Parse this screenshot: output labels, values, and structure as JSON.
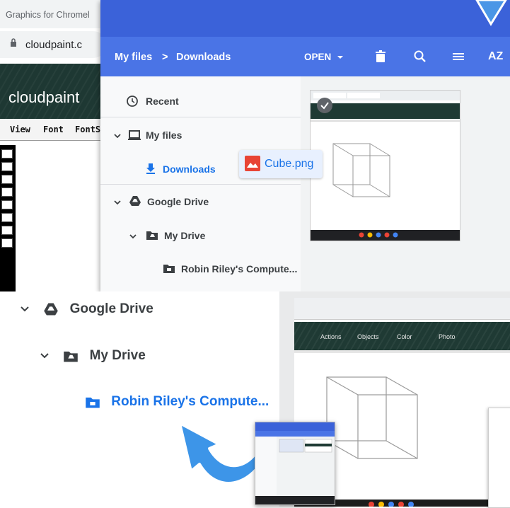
{
  "browser": {
    "tab_title": "Graphics for Chromel",
    "url": "cloudpaint.c",
    "brand": "cloudpaint",
    "menu": [
      "View",
      "Font",
      "FontS"
    ]
  },
  "files_app": {
    "breadcrumb": {
      "root": "My files",
      "separator": ">",
      "current": "Downloads"
    },
    "toolbar": {
      "open_label": "OPEN",
      "delete_icon": "trash-icon",
      "search_icon": "search-icon",
      "view_icon": "list-view-icon",
      "sort_label": "AZ"
    },
    "sidebar": {
      "recent": "Recent",
      "my_files": "My files",
      "downloads": "Downloads",
      "google_drive": "Google Drive",
      "my_drive": "My Drive",
      "computer": "Robin Riley's Compute..."
    },
    "drag_file": "Cube.png"
  },
  "zoom": {
    "google_drive": "Google Drive",
    "my_drive": "My Drive",
    "computer": "Robin Riley's Compute...",
    "preview_menu": [
      "Actions",
      "Objects",
      "Color",
      "Photo"
    ]
  },
  "colors": {
    "titlebar": "#3b62d9",
    "toolbar": "#4a74e6",
    "accent": "#1a73e8",
    "arrow": "#3d95e8"
  }
}
